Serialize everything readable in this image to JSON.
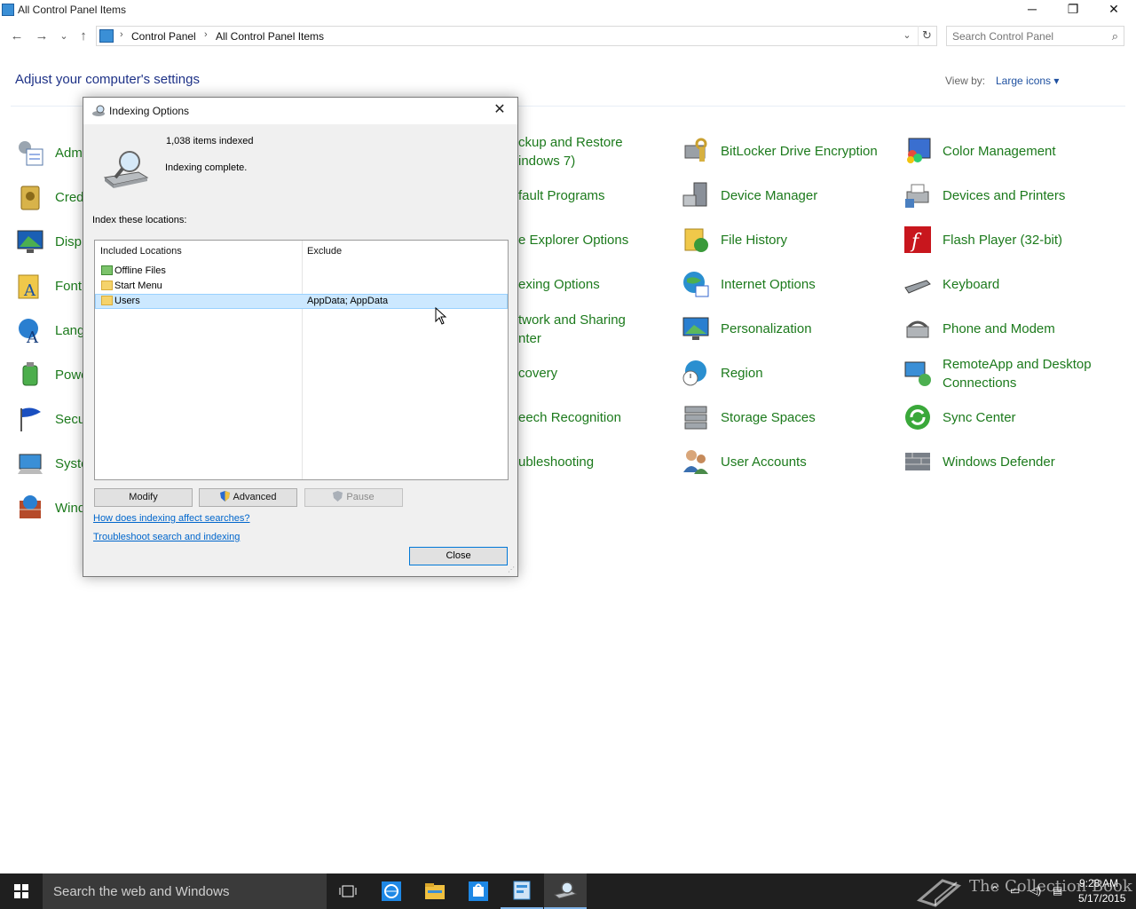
{
  "window": {
    "title": "All Control Panel Items",
    "minimize": "─",
    "restore": "❐",
    "close": "✕"
  },
  "nav": {
    "back": "←",
    "forward": "→",
    "recent": "⌄",
    "up": "↑",
    "breadcrumbs": [
      "Control Panel",
      "All Control Panel Items"
    ],
    "separator": "›",
    "dropdown": "⌄",
    "refresh": "↻",
    "search_placeholder": "Search Control Panel",
    "search_icon": "⌕"
  },
  "header": {
    "title": "Adjust your computer's settings",
    "view_by_label": "View by:",
    "view_by_value": "Large icons ▾"
  },
  "items_col1": [
    {
      "label": "Adm",
      "icon": "admin-tools-icon"
    },
    {
      "label": "Cred",
      "icon": "credential-manager-icon"
    },
    {
      "label": "Disp",
      "icon": "display-icon"
    },
    {
      "label": "Font",
      "icon": "fonts-icon"
    },
    {
      "label": "Lang",
      "icon": "language-icon"
    },
    {
      "label": "Powe",
      "icon": "power-options-icon"
    },
    {
      "label": "Secu",
      "icon": "security-maintenance-icon"
    },
    {
      "label": "Syste",
      "icon": "system-icon"
    },
    {
      "label": "Wind",
      "icon": "windows-firewall-icon"
    }
  ],
  "items_col2": [
    {
      "line1": "ckup and Restore",
      "line2": "indows 7)"
    },
    {
      "line1": "fault Programs"
    },
    {
      "line1": "e Explorer Options"
    },
    {
      "line1": "exing Options"
    },
    {
      "line1": "twork and Sharing",
      "line2": "nter"
    },
    {
      "line1": "covery"
    },
    {
      "line1": "eech Recognition"
    },
    {
      "line1": "ubleshooting"
    }
  ],
  "items_col3": [
    {
      "label": "BitLocker Drive Encryption",
      "icon": "bitlocker-icon"
    },
    {
      "label": "Device Manager",
      "icon": "device-manager-icon"
    },
    {
      "label": "File History",
      "icon": "file-history-icon"
    },
    {
      "label": "Internet Options",
      "icon": "internet-options-icon"
    },
    {
      "label": "Personalization",
      "icon": "personalization-icon"
    },
    {
      "label": "Region",
      "icon": "region-icon"
    },
    {
      "label": "Storage Spaces",
      "icon": "storage-spaces-icon"
    },
    {
      "label": "User Accounts",
      "icon": "user-accounts-icon"
    }
  ],
  "items_col4": [
    {
      "line1": "Color Management",
      "icon": "color-management-icon"
    },
    {
      "line1": "Devices and Printers",
      "icon": "devices-printers-icon"
    },
    {
      "line1": "Flash Player (32-bit)",
      "icon": "flash-player-icon"
    },
    {
      "line1": "Keyboard",
      "icon": "keyboard-icon"
    },
    {
      "line1": "Phone and Modem",
      "icon": "phone-modem-icon"
    },
    {
      "line1": "RemoteApp and Desktop",
      "line2": "Connections",
      "icon": "remoteapp-icon"
    },
    {
      "line1": "Sync Center",
      "icon": "sync-center-icon"
    },
    {
      "line1": "Windows Defender",
      "icon": "windows-defender-icon"
    }
  ],
  "dialog": {
    "title": "Indexing Options",
    "close": "✕",
    "items_indexed": "1,038 items indexed",
    "status": "Indexing complete.",
    "index_label": "Index these locations:",
    "columns": {
      "included": "Included Locations",
      "exclude": "Exclude"
    },
    "rows": [
      {
        "name": "Offline Files",
        "exclude": ""
      },
      {
        "name": "Start Menu",
        "exclude": ""
      },
      {
        "name": "Users",
        "exclude": "AppData; AppData"
      }
    ],
    "buttons": {
      "modify": "Modify",
      "advanced": "Advanced",
      "pause": "Pause",
      "close": "Close"
    },
    "links": {
      "how": "How does indexing affect searches?",
      "troubleshoot": "Troubleshoot search and indexing"
    }
  },
  "taskbar": {
    "search_placeholder": "Search the web and Windows",
    "time": "9:28 AM",
    "date": "5/17/2015",
    "watermark": "The Collection Book"
  },
  "colors": {
    "link_green": "#1c7a1c",
    "heading_blue": "#1e3287",
    "taskbar": "#1f1f1f",
    "selection": "#cce8ff"
  }
}
